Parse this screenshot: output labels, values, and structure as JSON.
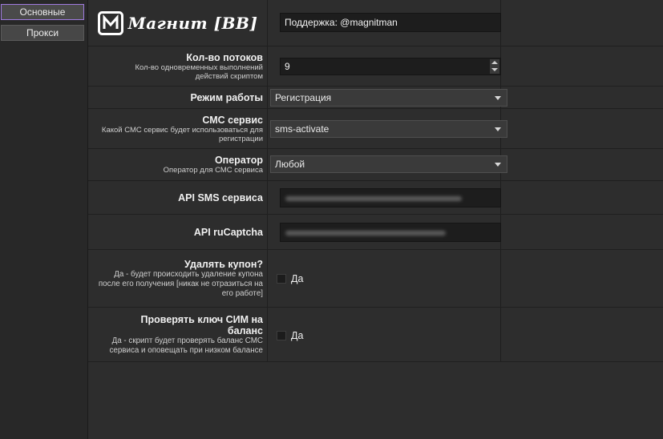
{
  "tabs": [
    {
      "label": "Основные",
      "active": true
    },
    {
      "label": "Прокси",
      "active": false
    }
  ],
  "header": {
    "logo_text": "Магнит [BB]",
    "support_value": "Поддержка: @magnitman"
  },
  "rows": {
    "threads": {
      "title": "Кол-во потоков",
      "desc": "Кол-во одновременных выполнений действий скриптом",
      "value": "9"
    },
    "mode": {
      "title": "Режим работы",
      "value": "Регистрация"
    },
    "sms_service": {
      "title": "СМС сервис",
      "desc": "Какой СМС сервис будет использоваться для регистрации",
      "value": "sms-activate"
    },
    "operator": {
      "title": "Оператор",
      "desc": "Оператор для СМС сервиса",
      "value": "Любой"
    },
    "api_sms": {
      "title": "API SMS сервиса"
    },
    "api_rucaptcha": {
      "title": "API ruCaptcha"
    },
    "delete_coupon": {
      "title": "Удалять купон?",
      "desc": "Да - будет происходить удаление купона после его получения [никак не отразиться на его работе]",
      "checkbox_label": "Да",
      "checked": false
    },
    "check_sim": {
      "title": "Проверять ключ СИМ на баланс",
      "desc": "Да - скрипт будет проверять баланс СМС сервиса и оповещать при низком балансе",
      "checkbox_label": "Да",
      "checked": false
    }
  },
  "colors": {
    "accent": "#a07be0",
    "background": "#2d2d2d"
  }
}
